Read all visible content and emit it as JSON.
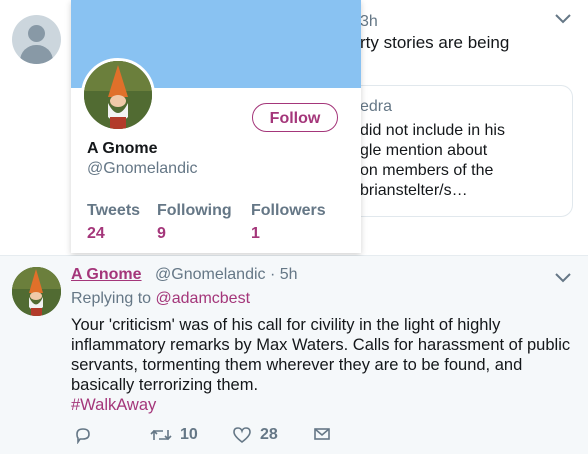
{
  "top_tweet": {
    "time_partial": "3h",
    "text_partial": "rty stories are being",
    "quote": {
      "name_partial": "edra",
      "lines": [
        "did not include in his",
        "gle mention about",
        "on members of the",
        "brianstelter/s…"
      ]
    }
  },
  "hover_card": {
    "name": "A Gnome",
    "handle": "@Gnomelandic",
    "follow_label": "Follow",
    "stats": {
      "tweets_label": "Tweets",
      "tweets": "24",
      "following_label": "Following",
      "following": "9",
      "followers_label": "Followers",
      "followers": "1"
    }
  },
  "bottom_tweet": {
    "name": "A Gnome",
    "handle_time": "@Gnomelandic · 5h",
    "replying_prefix": "Replying to",
    "replying_to": "@adamcbest",
    "text": "Your 'criticism' was of his call for civility in the light of highly inflammatory remarks by Max Waters. Calls for harassment of public servants, tormenting them wherever they are to be found, and basically terrorizing them.",
    "hashtag": "#WalkAway",
    "retweets": "10",
    "likes": "28"
  },
  "icons": {
    "reply": "reply-icon",
    "retweet": "retweet-icon",
    "like": "heart-icon",
    "dm": "envelope-icon",
    "caret": "chevron-down-icon"
  },
  "colors": {
    "accent": "#a4367a",
    "banner": "#89c2f2",
    "muted": "#657786"
  }
}
